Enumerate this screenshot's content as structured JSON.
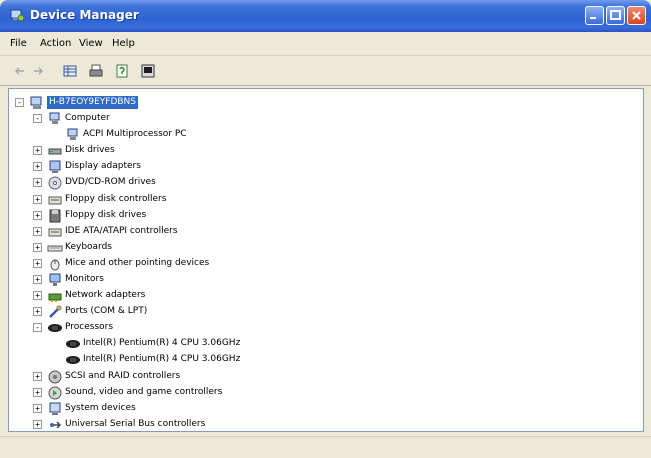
{
  "window": {
    "title": "Device Manager"
  },
  "menubar": {
    "items": [
      "File",
      "Action",
      "View",
      "Help"
    ]
  },
  "toolbar": {
    "buttons": [
      "back-icon",
      "forward-icon",
      "properties-grid-icon",
      "print-icon",
      "help-icon",
      "scan-hardware-icon"
    ]
  },
  "tree": {
    "root": "H-B7EOY9EYFDBNS",
    "nodes": [
      {
        "label": "Computer",
        "icon": "computer-icon",
        "expanded": true
      },
      {
        "label": "ACPI Multiprocessor PC",
        "icon": "computer-icon"
      },
      {
        "label": "Disk drives",
        "icon": "disk-drive-icon"
      },
      {
        "label": "Display adapters",
        "icon": "display-icon"
      },
      {
        "label": "DVD/CD-ROM drives",
        "icon": "cdrom-icon"
      },
      {
        "label": "Floppy disk controllers",
        "icon": "controller-icon"
      },
      {
        "label": "Floppy disk drives",
        "icon": "floppy-icon"
      },
      {
        "label": "IDE ATA/ATAPI controllers",
        "icon": "controller-icon"
      },
      {
        "label": "Keyboards",
        "icon": "keyboard-icon"
      },
      {
        "label": "Mice and other pointing devices",
        "icon": "mouse-icon"
      },
      {
        "label": "Monitors",
        "icon": "monitor-icon"
      },
      {
        "label": "Network adapters",
        "icon": "network-icon"
      },
      {
        "label": "Ports (COM & LPT)",
        "icon": "port-icon"
      },
      {
        "label": "Processors",
        "icon": "processor-icon",
        "expanded": true
      },
      {
        "label": "Intel(R) Pentium(R) 4 CPU 3.06GHz",
        "icon": "processor-icon"
      },
      {
        "label": "Intel(R) Pentium(R) 4 CPU 3.06GHz",
        "icon": "processor-icon"
      },
      {
        "label": "SCSI and RAID controllers",
        "icon": "scsi-icon"
      },
      {
        "label": "Sound, video and game controllers",
        "icon": "sound-icon"
      },
      {
        "label": "System devices",
        "icon": "system-icon"
      },
      {
        "label": "Universal Serial Bus controllers",
        "icon": "usb-icon"
      }
    ]
  }
}
